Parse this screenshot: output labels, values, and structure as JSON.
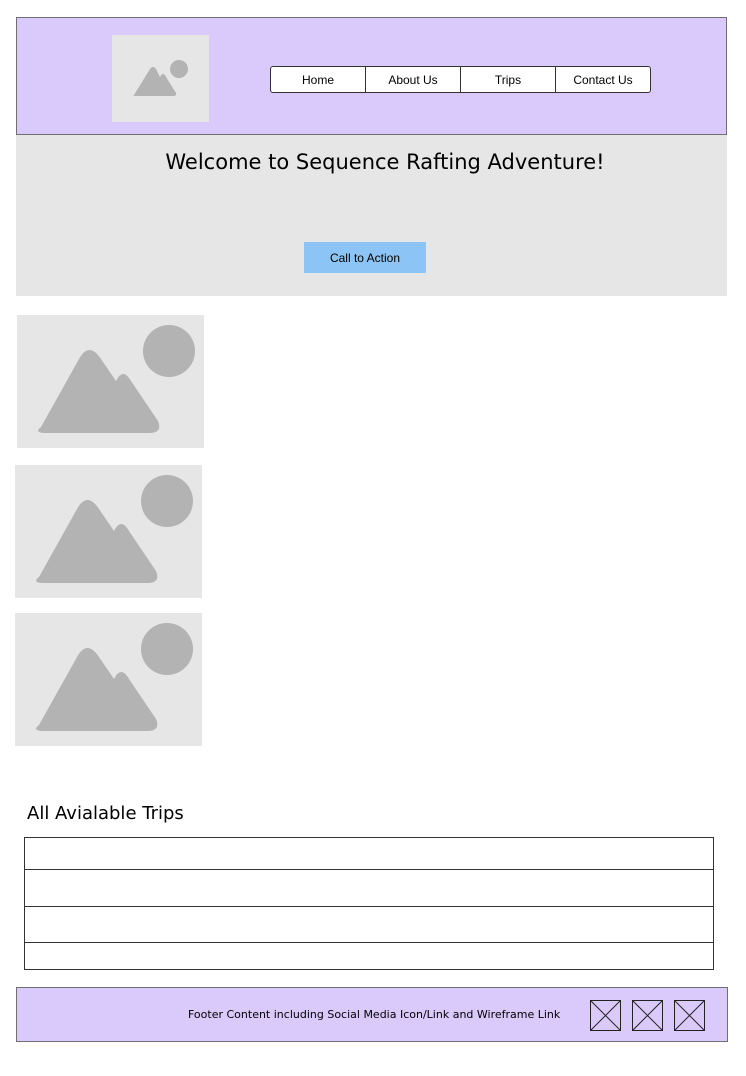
{
  "header": {
    "logo_icon": "image-placeholder-icon",
    "nav": [
      {
        "label": "Home"
      },
      {
        "label": "About Us"
      },
      {
        "label": "Trips"
      },
      {
        "label": "Contact Us"
      }
    ]
  },
  "hero": {
    "title": "Welcome to Sequence Rafting Adventure!",
    "cta_label": "Call to Action",
    "cta_color": "#8cc4f5"
  },
  "gallery": {
    "icon": "image-placeholder-icon",
    "count": 3
  },
  "trips": {
    "title": "All Avialable Trips",
    "rows": [
      "",
      "",
      "",
      ""
    ]
  },
  "footer": {
    "text": "Footer Content including Social Media Icon/Link and Wireframe Link",
    "social_icons": [
      "social-placeholder-icon",
      "social-placeholder-icon",
      "social-placeholder-icon"
    ]
  },
  "colors": {
    "header_bg": "#dac9fb",
    "placeholder_bg": "#e6e6e6",
    "placeholder_shape": "#b3b3b3",
    "cta_bg": "#8cc4f5"
  }
}
